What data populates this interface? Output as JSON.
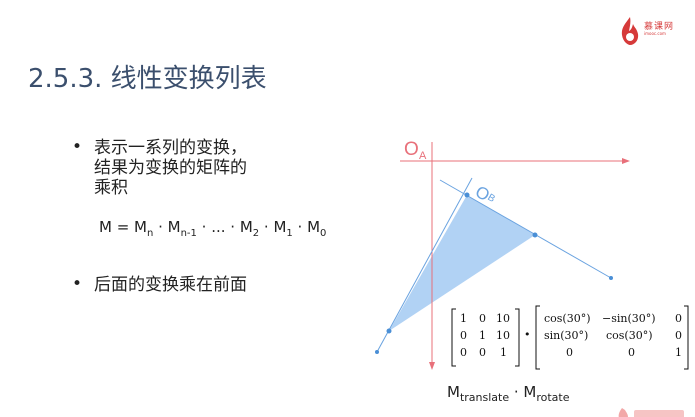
{
  "logo": {
    "text": "慕课网",
    "subtext": "imooc.com"
  },
  "title": "2.5.3. 线性变换列表",
  "bullets": {
    "first_lines": [
      "表示一系列的变换，",
      "结果为变换的矩阵的",
      "乘积"
    ],
    "second": "后面的变换乘在前面"
  },
  "formula": {
    "prefix": "M = M",
    "n": "n",
    "dot1": " · M",
    "n1": "n-1",
    "mid": " · ... · M",
    "two": "2",
    "dot2": " · M",
    "one": "1",
    "dot3": " · M",
    "zero": "0"
  },
  "diagram": {
    "label_oa": "O",
    "label_oa_sub": "A",
    "label_ob": "O",
    "label_ob_sub": "B",
    "colors": {
      "axis_red": "#e8707a",
      "axis_blue": "#6aa3e0",
      "triangle_fill": "#a9cdf3",
      "point_blue": "#4a8fd6"
    }
  },
  "matrix_translate": [
    [
      "1",
      "0",
      "10"
    ],
    [
      "0",
      "1",
      "10"
    ],
    [
      "0",
      "0",
      "1"
    ]
  ],
  "matrix_rotate": [
    [
      "cos(30°)",
      "−sin(30°)",
      "0"
    ],
    [
      "sin(30°)",
      "cos(30°)",
      "0"
    ],
    [
      "0",
      "0",
      "1"
    ]
  ],
  "dot_operator": "•",
  "caption": {
    "m1": "M",
    "translate": "translate",
    "dot": " · M",
    "rotate": "rotate"
  }
}
